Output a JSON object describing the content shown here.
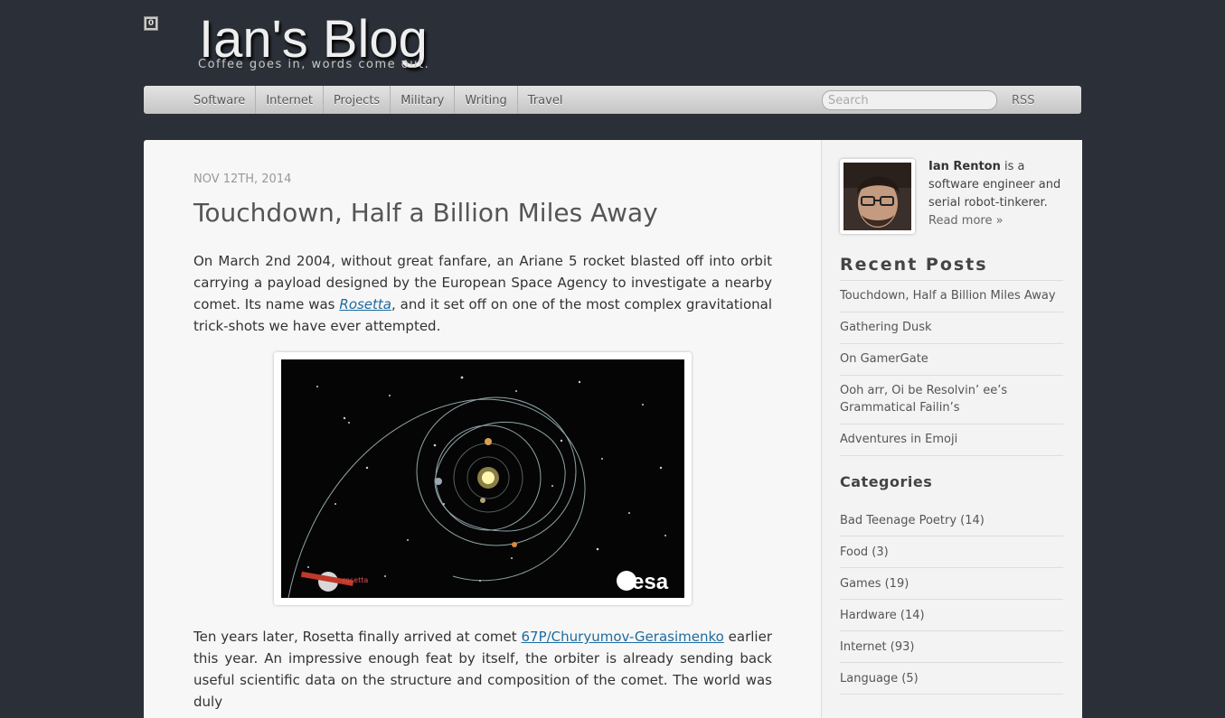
{
  "header": {
    "badge": "0",
    "title": "Ian's Blog",
    "tagline": "Coffee goes in, words come out."
  },
  "nav": {
    "items": [
      "Software",
      "Internet",
      "Projects",
      "Military",
      "Writing",
      "Travel"
    ],
    "search_placeholder": "Search",
    "rss": "RSS"
  },
  "post": {
    "date": "Nov 12th, 2014",
    "title": "Touchdown, Half a Billion Miles Away",
    "para1_before": "On March 2nd 2004, without great fanfare, an Ariane 5 rocket blasted off into orbit carrying a payload designed by the European Space Agency to investigate a nearby comet. Its name was ",
    "para1_link": "Rosetta",
    "para1_after": ", and it set off on one of the most complex gravitational trick-shots we have ever attempted.",
    "figure": {
      "spacecraft_label": "rosetta",
      "logo_text": "esa"
    },
    "para2_before": "Ten years later, Rosetta finally arrived at comet ",
    "para2_link": "67P/Churyumov-Gerasimenko",
    "para2_after": " earlier this year. An impressive enough feat by itself, the orbiter is already sending back useful scientific data on the structure and composition of the comet. The world was duly"
  },
  "sidebar": {
    "about": {
      "name": "Ian Renton",
      "text": " is a software engineer and serial robot-tinkerer.",
      "read_more": "Read more »"
    },
    "recent_heading": "Recent Posts",
    "recent_posts": [
      "Touchdown, Half a Billion Miles Away",
      "Gathering Dusk",
      "On GamerGate",
      "Ooh arr, Oi be Resolvin’ ee’s Grammatical Failin’s",
      "Adventures in Emoji"
    ],
    "categories_heading": "Categories",
    "categories": [
      "Bad Teenage Poetry (14)",
      "Food (3)",
      "Games (19)",
      "Hardware (14)",
      "Internet (93)",
      "Language (5)"
    ]
  },
  "colors": {
    "page_bg": "#2b2f37",
    "link": "#1e6a9e",
    "content_bg": "#f7f7f7"
  }
}
